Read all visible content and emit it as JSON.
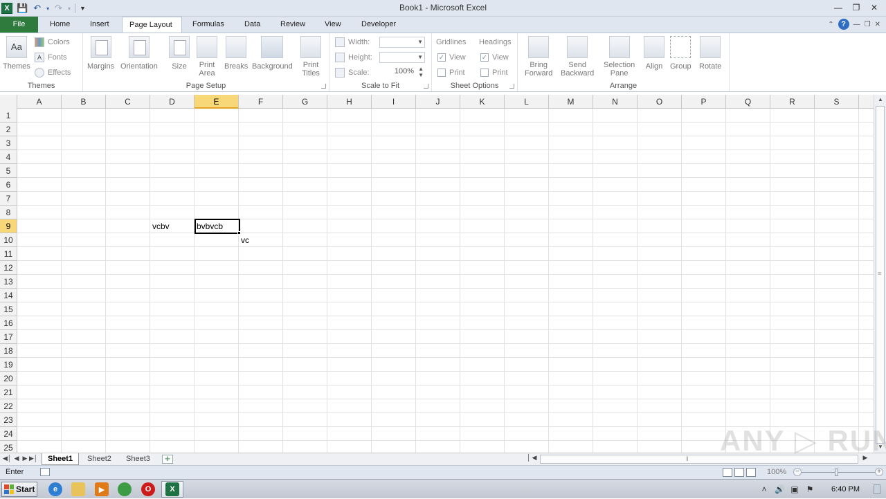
{
  "window": {
    "title": "Book1 - Microsoft Excel"
  },
  "qat": {
    "logo": "X",
    "save_icon": "save-icon",
    "undo_icon": "undo-icon",
    "redo_icon": "redo-icon"
  },
  "tabs": [
    {
      "label": "File"
    },
    {
      "label": "Home"
    },
    {
      "label": "Insert"
    },
    {
      "label": "Page Layout"
    },
    {
      "label": "Formulas"
    },
    {
      "label": "Data"
    },
    {
      "label": "Review"
    },
    {
      "label": "View"
    },
    {
      "label": "Developer"
    }
  ],
  "active_tab": "Page Layout",
  "ribbon": {
    "themes": {
      "label": "Themes",
      "themes_btn": "Themes",
      "colors": "Colors",
      "fonts": "Fonts",
      "effects": "Effects"
    },
    "page_setup": {
      "label": "Page Setup",
      "margins": "Margins",
      "orientation": "Orientation",
      "size": "Size",
      "print_area_1": "Print",
      "print_area_2": "Area",
      "breaks": "Breaks",
      "background": "Background",
      "print_titles_1": "Print",
      "print_titles_2": "Titles"
    },
    "scale_to_fit": {
      "label": "Scale to Fit",
      "width": "Width:",
      "height": "Height:",
      "scale": "Scale:",
      "scale_value": "100%"
    },
    "sheet_options": {
      "label": "Sheet Options",
      "gridlines": "Gridlines",
      "headings": "Headings",
      "view": "View",
      "print": "Print"
    },
    "arrange": {
      "label": "Arrange",
      "bring_forward_1": "Bring",
      "bring_forward_2": "Forward",
      "send_backward_1": "Send",
      "send_backward_2": "Backward",
      "selection_pane_1": "Selection",
      "selection_pane_2": "Pane",
      "align": "Align",
      "group": "Group",
      "rotate": "Rotate"
    }
  },
  "sheet": {
    "columns": [
      "A",
      "B",
      "C",
      "D",
      "E",
      "F",
      "G",
      "H",
      "I",
      "J",
      "K",
      "L",
      "M",
      "N",
      "O",
      "P",
      "Q",
      "R",
      "S"
    ],
    "selected_column": "E",
    "rows": [
      "1",
      "2",
      "3",
      "4",
      "5",
      "6",
      "7",
      "8",
      "9",
      "10",
      "11",
      "12",
      "13",
      "14",
      "15",
      "16",
      "17",
      "18",
      "19",
      "20",
      "21",
      "22",
      "23",
      "24",
      "25"
    ],
    "selected_row": "9",
    "cells": {
      "D9": "vcbv",
      "E9": "bvbvcb",
      "F10": "vc"
    }
  },
  "sheet_tabs": [
    {
      "label": "Sheet1"
    },
    {
      "label": "Sheet2"
    },
    {
      "label": "Sheet3"
    }
  ],
  "active_sheet": "Sheet1",
  "status": {
    "mode": "Enter",
    "zoom": "100%"
  },
  "taskbar": {
    "start": "Start",
    "clock": "6:40 PM"
  },
  "watermark": "ANY RUN"
}
